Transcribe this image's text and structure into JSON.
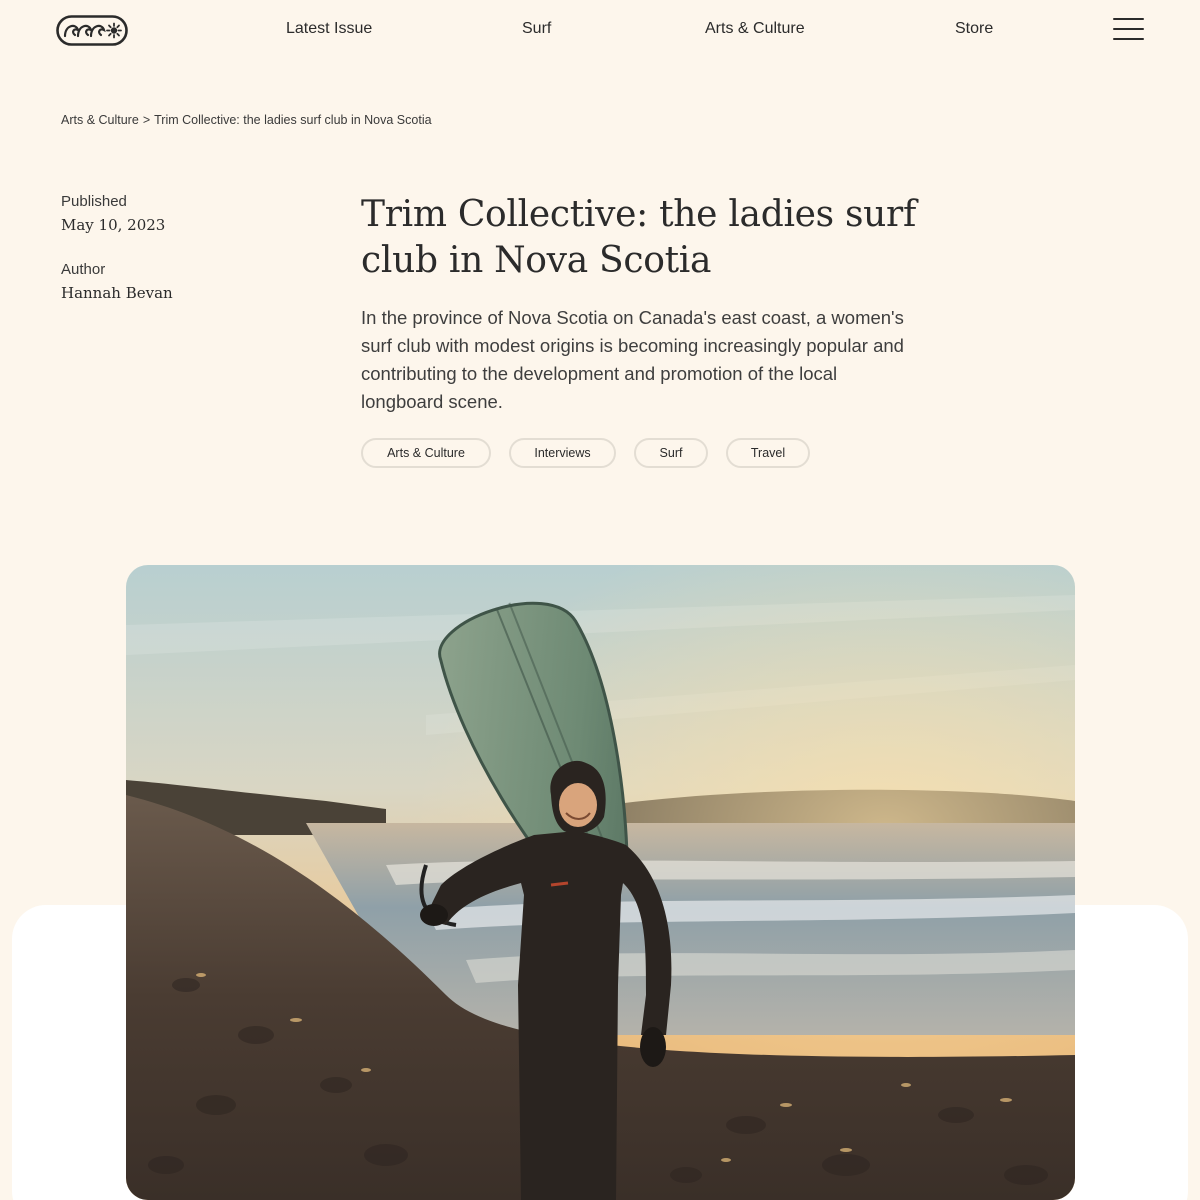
{
  "header": {
    "logo_name": "magazine-logo",
    "nav": [
      {
        "label": "Latest Issue"
      },
      {
        "label": "Surf"
      },
      {
        "label": "Arts & Culture"
      },
      {
        "label": "Store"
      }
    ],
    "menu_icon": "hamburger-menu-icon"
  },
  "breadcrumb": {
    "parent": "Arts & Culture",
    "separator": ">",
    "current": "Trim Collective: the ladies surf club in Nova Scotia"
  },
  "meta": {
    "published_label": "Published",
    "published_value": "May 10, 2023",
    "author_label": "Author",
    "author_value": "Hannah Bevan"
  },
  "article": {
    "title": "Trim Collective: the ladies surf club in Nova Scotia",
    "summary": "In the province of Nova Scotia on Canada's east coast, a women's surf club with modest origins is becoming increasingly popular and contributing to the development and promotion of the local longboard scene.",
    "tags": [
      {
        "label": "Arts & Culture"
      },
      {
        "label": "Interviews"
      },
      {
        "label": "Surf"
      },
      {
        "label": "Travel"
      }
    ]
  },
  "colors": {
    "background": "#fdf6ec",
    "text": "#2b2b2b",
    "panel": "#ffffff",
    "tag_border": "#e3ddd3"
  }
}
